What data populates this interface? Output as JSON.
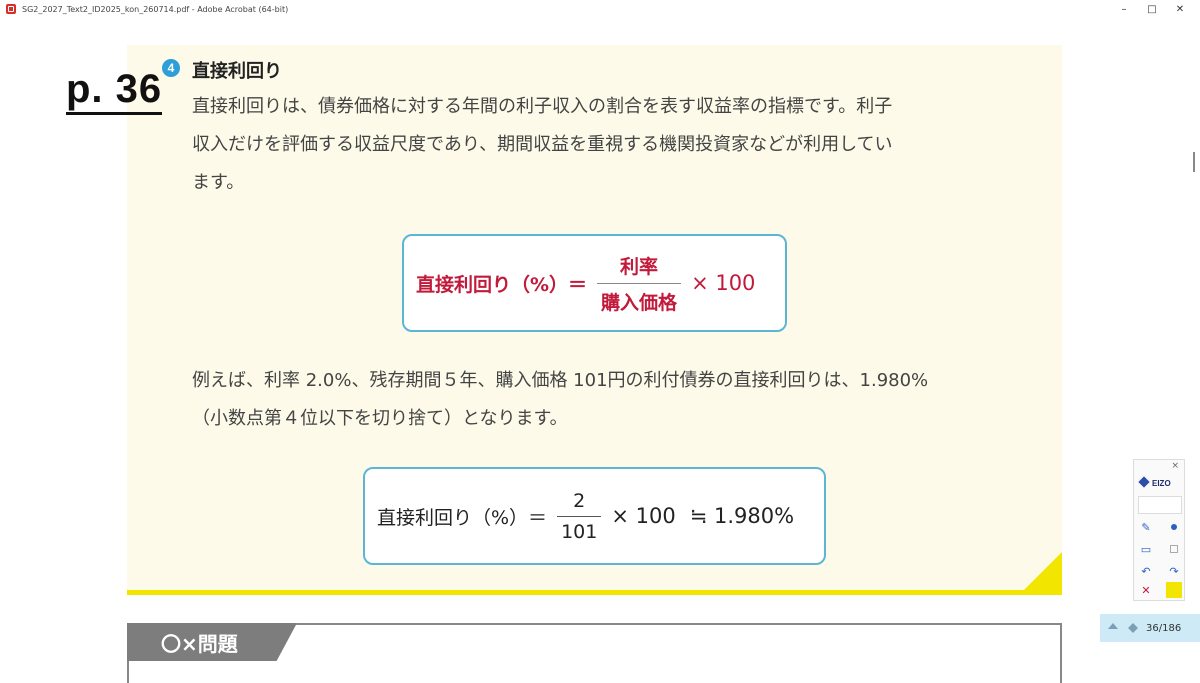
{
  "window": {
    "title": "SG2_2027_Text2_ID2025_kon_260714.pdf - Adobe Acrobat (64-bit)",
    "buttons": {
      "minimize": "–",
      "maximize": "□",
      "close": "✕"
    }
  },
  "page": {
    "page_label": "p. 36",
    "badge": "4",
    "heading": "直接利回り",
    "para1_line1": "直接利回りは、債券価格に対する年間の利子収入の割合を表す収益率の指標です。利子",
    "para1_line2": "収入だけを評価する収益尺度であり、期間収益を重視する機関投資家などが利用してい",
    "para1_line3": "ます。",
    "formula1": {
      "label": "直接利回り（%）＝",
      "numerator": "利率",
      "denominator": "購入価格",
      "multiplier": "× 100"
    },
    "para2_line1": "例えば、利率 2.0%、残存期間５年、購入価格 101円の利付債券の直接利回りは、1.980%",
    "para2_line2": "（小数点第４位以下を切り捨て）となります。",
    "formula2": {
      "label": "直接利回り（%）＝",
      "numerator": "2",
      "denominator": "101",
      "multiplier": "× 100",
      "result": "≒ 1.980%"
    },
    "quiz_tab": "〇×問題"
  },
  "eizo_toolbar": {
    "close": "×",
    "logo": "EIZO"
  },
  "page_indicator": "36/186",
  "colors": {
    "panel_bg": "#fdfae9",
    "accent_yellow": "#f2e600",
    "formula_border": "#5bb6d6",
    "formula_red": "#c21a3a",
    "badge_blue": "#2d9fd8"
  }
}
